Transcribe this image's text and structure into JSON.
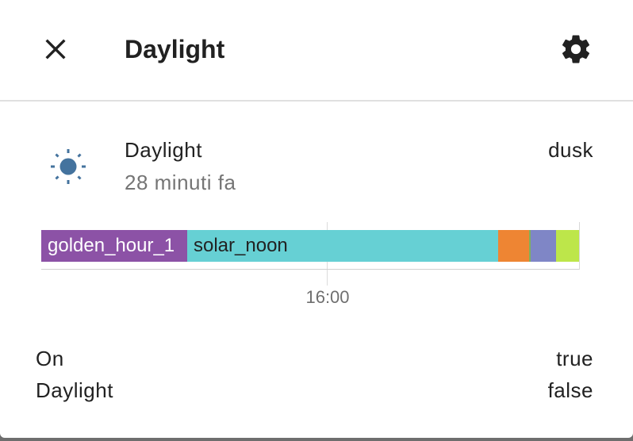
{
  "dialog": {
    "title": "Daylight",
    "close_icon": "close-icon",
    "settings_icon": "gear-icon"
  },
  "entity": {
    "icon": "sun-icon",
    "icon_color": "#44739e",
    "name": "Daylight",
    "last_changed": "28 minuti fa",
    "state": "dusk"
  },
  "timeline": {
    "segments": [
      {
        "label": "golden_hour_1",
        "color": "#8c52a6"
      },
      {
        "label": "solar_noon",
        "color": "#66d0d4"
      },
      {
        "label": "",
        "color": "#ee8533"
      },
      {
        "label": "",
        "color": "#7fb05d"
      },
      {
        "label": "",
        "color": "#7f86c6"
      },
      {
        "label": "",
        "color": "#bde64a"
      }
    ],
    "tick_label": "16:00"
  },
  "attributes": [
    {
      "name": "On",
      "value": "true"
    },
    {
      "name": "Daylight",
      "value": "false"
    }
  ]
}
